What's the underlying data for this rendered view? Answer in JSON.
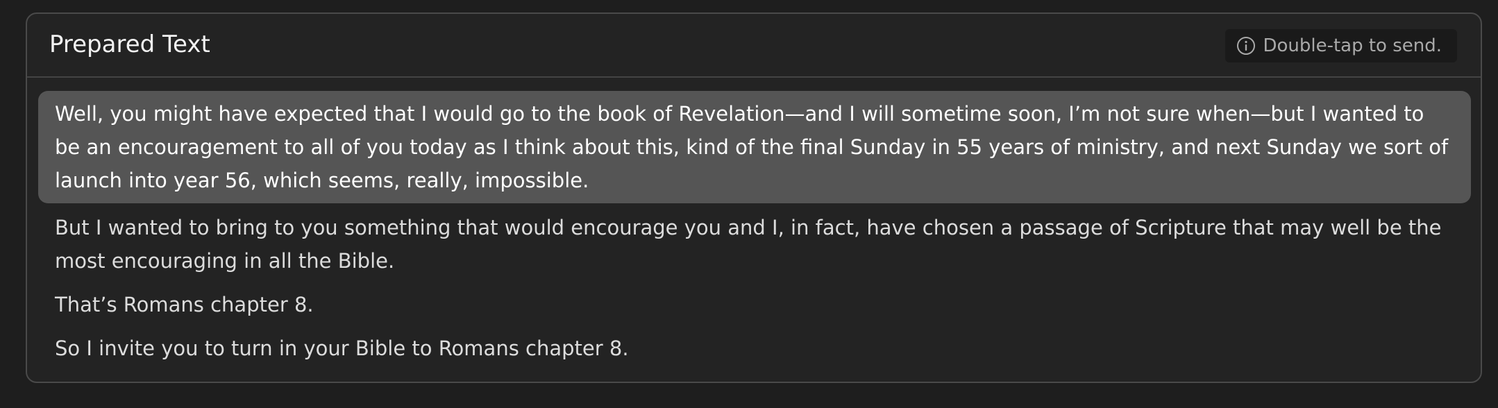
{
  "panel": {
    "title": "Prepared Text",
    "hint": {
      "icon": "info-icon",
      "text": "Double-tap to send."
    }
  },
  "paragraphs": [
    {
      "text": "Well, you might have expected that I would go to the book of Revelation—and I will sometime soon, I’m not sure when—but I wanted to be an encouragement to all of you today as I think about this, kind of the final Sunday in 55 years of ministry, and next Sunday we sort of launch into year 56, which seems, really, impossible.",
      "selected": true
    },
    {
      "text": "But I wanted to bring to you something that would encourage you and I, in fact, have chosen a passage of Scripture that may well be the most encouraging in all the Bible.",
      "selected": false
    },
    {
      "text": "That’s Romans chapter 8.",
      "selected": false
    },
    {
      "text": "So I invite you to turn in your Bible to Romans chapter 8.",
      "selected": false
    }
  ],
  "colors": {
    "background": "#1e1e1e",
    "panel": "#232323",
    "selected_highlight": "#555555",
    "text": "#dcdcdc"
  }
}
